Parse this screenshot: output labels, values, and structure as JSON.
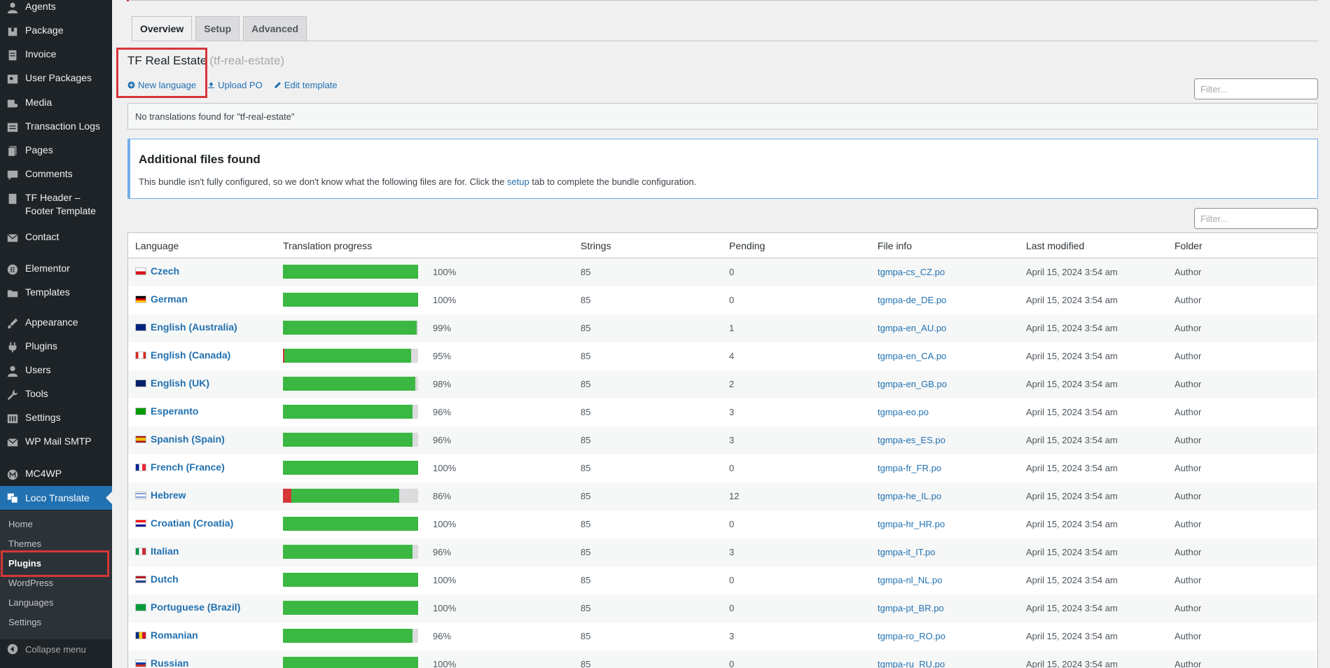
{
  "sidebar": {
    "items": [
      {
        "label": "Agents",
        "icon": "person-icon"
      },
      {
        "label": "Package",
        "icon": "package-icon"
      },
      {
        "label": "Invoice",
        "icon": "invoice-icon"
      },
      {
        "label": "User Packages",
        "icon": "user-packages-icon"
      },
      {
        "label": "Media",
        "icon": "media-icon"
      },
      {
        "label": "Transaction Logs",
        "icon": "logs-icon"
      },
      {
        "label": "Pages",
        "icon": "pages-icon"
      },
      {
        "label": "Comments",
        "icon": "comment-icon"
      },
      {
        "label": "TF Header – Footer Template",
        "icon": "template-icon"
      },
      {
        "label": "Contact",
        "icon": "mail-icon"
      },
      {
        "label": "Elementor",
        "icon": "elementor-icon"
      },
      {
        "label": "Templates",
        "icon": "folder-icon"
      },
      {
        "label": "Appearance",
        "icon": "brush-icon"
      },
      {
        "label": "Plugins",
        "icon": "plug-icon"
      },
      {
        "label": "Users",
        "icon": "users-icon"
      },
      {
        "label": "Tools",
        "icon": "wrench-icon"
      },
      {
        "label": "Settings",
        "icon": "settings-icon"
      },
      {
        "label": "WP Mail SMTP",
        "icon": "mail-icon"
      },
      {
        "label": "MC4WP",
        "icon": "mc4wp-icon"
      },
      {
        "label": "Loco Translate",
        "icon": "translate-icon"
      }
    ],
    "submenu": [
      "Home",
      "Themes",
      "Plugins",
      "WordPress",
      "Languages",
      "Settings"
    ],
    "current_sub": "Plugins",
    "collapse_label": "Collapse menu"
  },
  "tabs": [
    "Overview",
    "Setup",
    "Advanced"
  ],
  "bundle": {
    "title": "TF Real Estate",
    "slug": "(tf-real-estate)"
  },
  "actions": {
    "new_language": "New language",
    "upload_po": "Upload PO",
    "edit_template": "Edit template"
  },
  "filter_placeholder": "Filter...",
  "notice": "No translations found for \"tf-real-estate\"",
  "additional": {
    "title": "Additional files found",
    "text_before": "This bundle isn't fully configured, so we don't know what the following files are for. Click the",
    "link": "setup",
    "text_after": "tab to complete the bundle configuration."
  },
  "table": {
    "columns": [
      "Language",
      "Translation progress",
      "Strings",
      "Pending",
      "File info",
      "Last modified",
      "Folder"
    ],
    "rows": [
      {
        "language": "Czech",
        "flag": "cz",
        "progress": 100,
        "untranslated": 0,
        "fuzzy": 0,
        "pct": "100%",
        "strings": "85",
        "pending": "0",
        "file": "tgmpa-cs_CZ.po",
        "modified": "April 15, 2024 3:54 am",
        "folder": "Author"
      },
      {
        "language": "German",
        "flag": "de",
        "progress": 100,
        "untranslated": 0,
        "fuzzy": 0,
        "pct": "100%",
        "strings": "85",
        "pending": "0",
        "file": "tgmpa-de_DE.po",
        "modified": "April 15, 2024 3:54 am",
        "folder": "Author"
      },
      {
        "language": "English (Australia)",
        "flag": "au",
        "progress": 99,
        "untranslated": 1,
        "fuzzy": 0,
        "pct": "99%",
        "strings": "85",
        "pending": "1",
        "file": "tgmpa-en_AU.po",
        "modified": "April 15, 2024 3:54 am",
        "folder": "Author"
      },
      {
        "language": "English (Canada)",
        "flag": "ca",
        "progress": 95,
        "untranslated": 4,
        "fuzzy": 1,
        "pct": "95%",
        "strings": "85",
        "pending": "4",
        "file": "tgmpa-en_CA.po",
        "modified": "April 15, 2024 3:54 am",
        "folder": "Author"
      },
      {
        "language": "English (UK)",
        "flag": "gb",
        "progress": 98,
        "untranslated": 2,
        "fuzzy": 0,
        "pct": "98%",
        "strings": "85",
        "pending": "2",
        "file": "tgmpa-en_GB.po",
        "modified": "April 15, 2024 3:54 am",
        "folder": "Author"
      },
      {
        "language": "Esperanto",
        "flag": "eo",
        "progress": 96,
        "untranslated": 4,
        "fuzzy": 0,
        "pct": "96%",
        "strings": "85",
        "pending": "3",
        "file": "tgmpa-eo.po",
        "modified": "April 15, 2024 3:54 am",
        "folder": "Author"
      },
      {
        "language": "Spanish (Spain)",
        "flag": "es",
        "progress": 96,
        "untranslated": 4,
        "fuzzy": 0,
        "pct": "96%",
        "strings": "85",
        "pending": "3",
        "file": "tgmpa-es_ES.po",
        "modified": "April 15, 2024 3:54 am",
        "folder": "Author"
      },
      {
        "language": "French (France)",
        "flag": "fr",
        "progress": 100,
        "untranslated": 0,
        "fuzzy": 0,
        "pct": "100%",
        "strings": "85",
        "pending": "0",
        "file": "tgmpa-fr_FR.po",
        "modified": "April 15, 2024 3:54 am",
        "folder": "Author"
      },
      {
        "language": "Hebrew",
        "flag": "il",
        "progress": 86,
        "untranslated": 8,
        "fuzzy": 6,
        "pct": "86%",
        "strings": "85",
        "pending": "12",
        "file": "tgmpa-he_IL.po",
        "modified": "April 15, 2024 3:54 am",
        "folder": "Author"
      },
      {
        "language": "Croatian (Croatia)",
        "flag": "hr",
        "progress": 100,
        "untranslated": 0,
        "fuzzy": 0,
        "pct": "100%",
        "strings": "85",
        "pending": "0",
        "file": "tgmpa-hr_HR.po",
        "modified": "April 15, 2024 3:54 am",
        "folder": "Author"
      },
      {
        "language": "Italian",
        "flag": "it",
        "progress": 96,
        "untranslated": 4,
        "fuzzy": 0,
        "pct": "96%",
        "strings": "85",
        "pending": "3",
        "file": "tgmpa-it_IT.po",
        "modified": "April 15, 2024 3:54 am",
        "folder": "Author"
      },
      {
        "language": "Dutch",
        "flag": "nl",
        "progress": 100,
        "untranslated": 0,
        "fuzzy": 0,
        "pct": "100%",
        "strings": "85",
        "pending": "0",
        "file": "tgmpa-nl_NL.po",
        "modified": "April 15, 2024 3:54 am",
        "folder": "Author"
      },
      {
        "language": "Portuguese (Brazil)",
        "flag": "br",
        "progress": 100,
        "untranslated": 0,
        "fuzzy": 0,
        "pct": "100%",
        "strings": "85",
        "pending": "0",
        "file": "tgmpa-pt_BR.po",
        "modified": "April 15, 2024 3:54 am",
        "folder": "Author"
      },
      {
        "language": "Romanian",
        "flag": "ro",
        "progress": 96,
        "untranslated": 4,
        "fuzzy": 0,
        "pct": "96%",
        "strings": "85",
        "pending": "3",
        "file": "tgmpa-ro_RO.po",
        "modified": "April 15, 2024 3:54 am",
        "folder": "Author"
      },
      {
        "language": "Russian",
        "flag": "ru",
        "progress": 100,
        "untranslated": 0,
        "fuzzy": 0,
        "pct": "100%",
        "strings": "85",
        "pending": "0",
        "file": "tgmpa-ru_RU.po",
        "modified": "April 15, 2024 3:54 am",
        "folder": "Author"
      }
    ]
  },
  "colors": {
    "sidebar_bg": "#1d2327",
    "accent": "#2271b1",
    "progress_green": "#3bb843",
    "progress_red": "#d63638",
    "highlight": "#d63638"
  }
}
